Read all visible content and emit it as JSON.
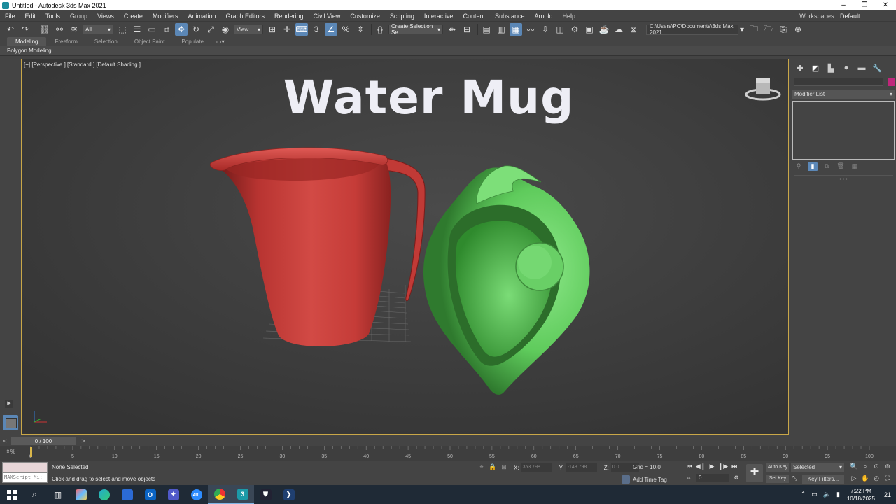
{
  "window": {
    "title": "Untitled - Autodesk 3ds Max 2021",
    "controls": [
      "–",
      "❐",
      "✕"
    ]
  },
  "menu": {
    "items": [
      "File",
      "Edit",
      "Tools",
      "Group",
      "Views",
      "Create",
      "Modifiers",
      "Animation",
      "Graph Editors",
      "Rendering",
      "Civil View",
      "Customize",
      "Scripting",
      "Interactive",
      "Content",
      "Substance",
      "Arnold",
      "Help"
    ],
    "workspaces_label": "Workspaces:",
    "workspaces_value": "Default"
  },
  "toolbar": {
    "selection_filter": "All",
    "ref_coord": "View",
    "named_selection": "Create Selection Se",
    "project_path": "C:\\Users\\PC\\Documents\\3ds Max 2021"
  },
  "ribbon": {
    "tabs": [
      "Modeling",
      "Freeform",
      "Selection",
      "Object Paint",
      "Populate"
    ],
    "active_tab": "Modeling",
    "sub_label": "Polygon Modeling"
  },
  "viewport": {
    "label": "[+] [Perspective ] [Standard ] [Default Shading ]",
    "overlay_title": "Water Mug",
    "colors": {
      "red_mug": "#c8403c",
      "green_mug": "#6fd36c",
      "background": "#3c3c3c",
      "border": "#c9a748"
    }
  },
  "command_panel": {
    "modifier_list_label": "Modifier List",
    "object_color": "#c0267b"
  },
  "timeline": {
    "slider_text": "0 / 100",
    "ticks": [
      "0",
      "5",
      "10",
      "15",
      "20",
      "25",
      "30",
      "35",
      "40",
      "45",
      "50",
      "55",
      "60",
      "65",
      "70",
      "75",
      "80",
      "85",
      "90",
      "95",
      "100"
    ]
  },
  "status": {
    "maxscript_placeholder": "MAXScript Mi:",
    "selection_status": "None Selected",
    "prompt": "Click and drag to select and move objects",
    "x_label": "X:",
    "x_value": "353.798",
    "y_label": "Y:",
    "y_value": "-148.798",
    "z_label": "Z:",
    "z_value": "0.0",
    "grid": "Grid = 10.0",
    "add_time_tag": "Add Time Tag",
    "frame_value": "0",
    "auto_key": "Auto Key",
    "set_key": "Set Key",
    "selected_dropdown": "Selected",
    "key_filters": "Key Filters..."
  },
  "taskbar": {
    "time": "7:22 PM",
    "date": "10/18/2025",
    "notifications": "21",
    "apps": [
      "windows-start",
      "search",
      "task-view",
      "copilot",
      "edge",
      "store",
      "outlook",
      "teams",
      "zoom",
      "chrome",
      "3ds-max",
      "shield-app",
      "powershell"
    ]
  }
}
